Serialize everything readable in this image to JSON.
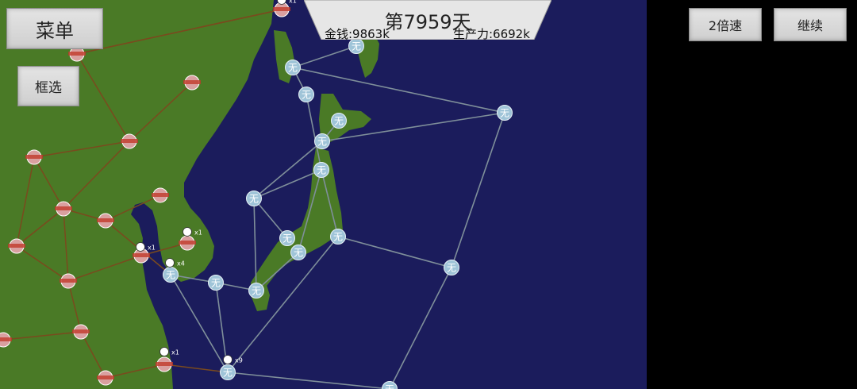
{
  "menu_label": "菜单",
  "select_label": "框选",
  "speed_label": "2倍速",
  "continue_label": "继续",
  "day_text": "第7959天",
  "money_text": "金钱:9863k",
  "production_text": "生产力:6692k",
  "colors": {
    "sea": "#1b1c5c",
    "land": "#4a7a26",
    "road": "#7a4a1e",
    "sea_route": "#7f8f9a",
    "neutral_node": "#9fc4d8",
    "enemy_node": "#d9a0a0"
  },
  "nodes": [
    {
      "id": "n1",
      "label": "无"
    },
    {
      "id": "n2",
      "label": "无"
    },
    {
      "id": "n3",
      "label": "无"
    },
    {
      "id": "n4",
      "label": "无"
    },
    {
      "id": "n5",
      "label": "无"
    },
    {
      "id": "n6",
      "label": "无"
    },
    {
      "id": "n7",
      "label": "无"
    },
    {
      "id": "n8",
      "label": "无"
    },
    {
      "id": "n9",
      "label": "无"
    },
    {
      "id": "n10",
      "label": "无"
    },
    {
      "id": "n11",
      "label": "无"
    },
    {
      "id": "n12",
      "label": "无"
    },
    {
      "id": "n13",
      "label": "无"
    },
    {
      "id": "n14",
      "label": "无"
    },
    {
      "id": "n15",
      "label": "无"
    },
    {
      "id": "n16",
      "label": "无"
    }
  ],
  "army_counts": [
    "x1",
    "x1",
    "x1",
    "x4",
    "x1",
    "x9"
  ]
}
